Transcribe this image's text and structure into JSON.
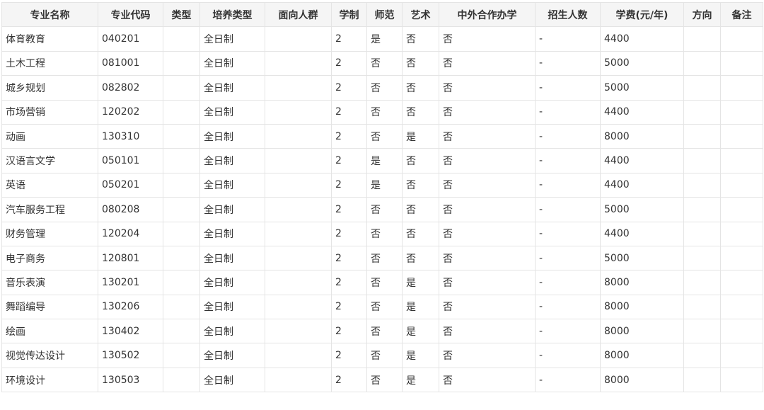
{
  "table": {
    "headers": [
      "专业名称",
      "专业代码",
      "类型",
      "培养类型",
      "面向人群",
      "学制",
      "师范",
      "艺术",
      "中外合作办学",
      "招生人数",
      "学费(元/年)",
      "方向",
      "备注"
    ],
    "rows": [
      [
        "体育教育",
        "040201",
        "",
        "全日制",
        "",
        "2",
        "是",
        "否",
        "否",
        "-",
        "4400",
        "",
        ""
      ],
      [
        "土木工程",
        "081001",
        "",
        "全日制",
        "",
        "2",
        "否",
        "否",
        "否",
        "-",
        "5000",
        "",
        ""
      ],
      [
        "城乡规划",
        "082802",
        "",
        "全日制",
        "",
        "2",
        "否",
        "否",
        "否",
        "-",
        "5000",
        "",
        ""
      ],
      [
        "市场营销",
        "120202",
        "",
        "全日制",
        "",
        "2",
        "否",
        "否",
        "否",
        "-",
        "4400",
        "",
        ""
      ],
      [
        "动画",
        "130310",
        "",
        "全日制",
        "",
        "2",
        "否",
        "是",
        "否",
        "-",
        "8000",
        "",
        ""
      ],
      [
        "汉语言文学",
        "050101",
        "",
        "全日制",
        "",
        "2",
        "是",
        "否",
        "否",
        "-",
        "4400",
        "",
        ""
      ],
      [
        "英语",
        "050201",
        "",
        "全日制",
        "",
        "2",
        "是",
        "否",
        "否",
        "-",
        "4400",
        "",
        ""
      ],
      [
        "汽车服务工程",
        "080208",
        "",
        "全日制",
        "",
        "2",
        "否",
        "否",
        "否",
        "-",
        "5000",
        "",
        ""
      ],
      [
        "财务管理",
        "120204",
        "",
        "全日制",
        "",
        "2",
        "否",
        "否",
        "否",
        "-",
        "4400",
        "",
        ""
      ],
      [
        "电子商务",
        "120801",
        "",
        "全日制",
        "",
        "2",
        "否",
        "否",
        "否",
        "-",
        "5000",
        "",
        ""
      ],
      [
        "音乐表演",
        "130201",
        "",
        "全日制",
        "",
        "2",
        "否",
        "是",
        "否",
        "-",
        "8000",
        "",
        ""
      ],
      [
        "舞蹈编导",
        "130206",
        "",
        "全日制",
        "",
        "2",
        "否",
        "是",
        "否",
        "-",
        "8000",
        "",
        ""
      ],
      [
        "绘画",
        "130402",
        "",
        "全日制",
        "",
        "2",
        "否",
        "是",
        "否",
        "-",
        "8000",
        "",
        ""
      ],
      [
        "视觉传达设计",
        "130502",
        "",
        "全日制",
        "",
        "2",
        "否",
        "是",
        "否",
        "-",
        "8000",
        "",
        ""
      ],
      [
        "环境设计",
        "130503",
        "",
        "全日制",
        "",
        "2",
        "否",
        "是",
        "否",
        "-",
        "8000",
        "",
        ""
      ]
    ]
  }
}
